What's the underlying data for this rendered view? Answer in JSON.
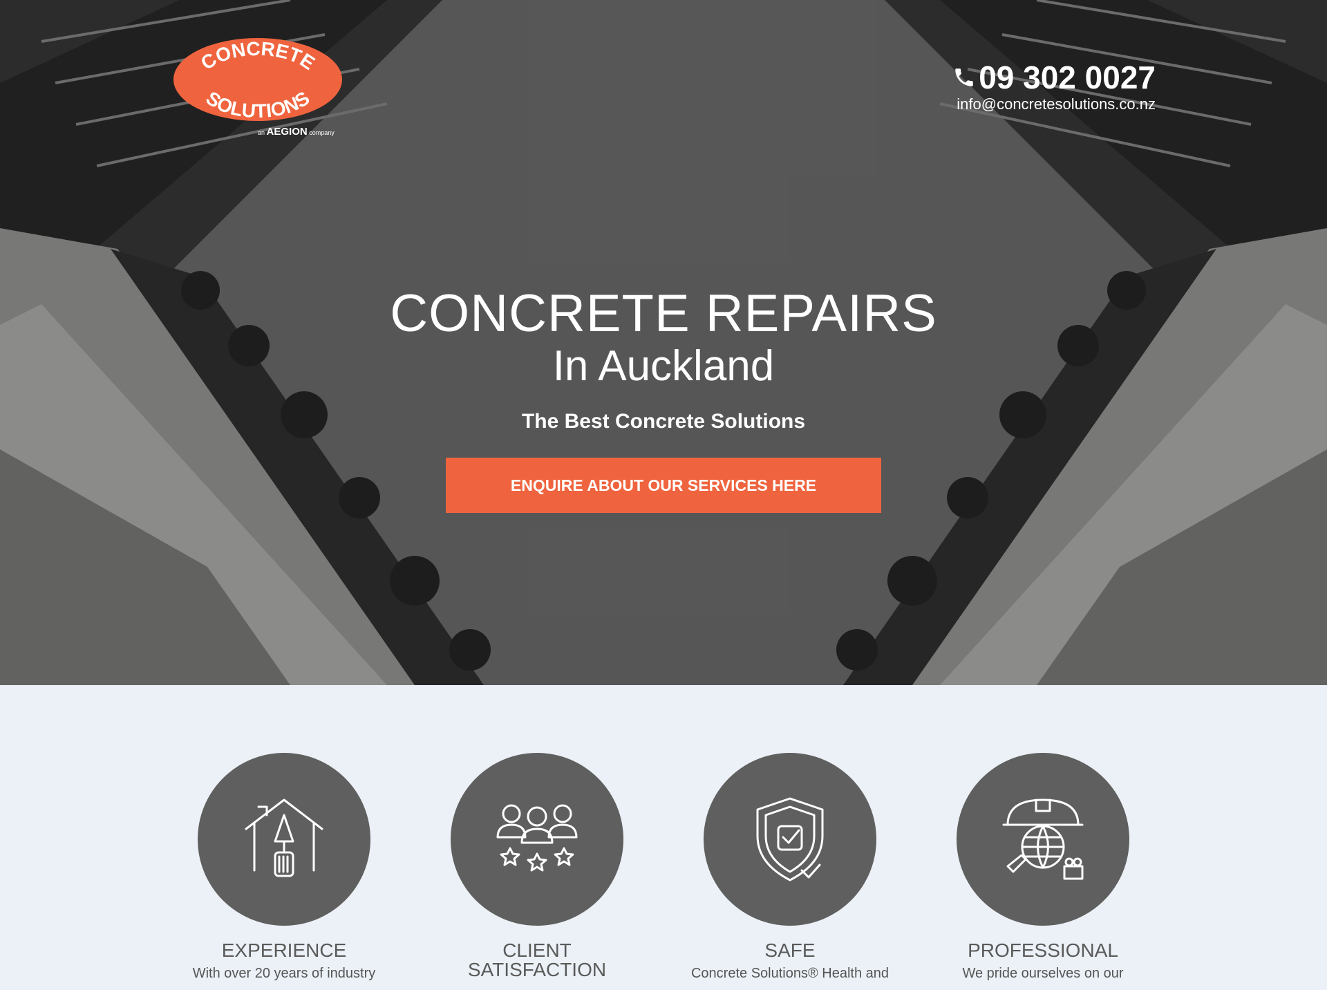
{
  "brand": {
    "logo_line1": "CONCRETE",
    "logo_line2": "SOLUTIONS",
    "logo_sub_prefix": "an",
    "logo_sub_brand": "AEGION",
    "logo_sub_suffix": "company",
    "accent_color": "#ef643e"
  },
  "contact": {
    "phone": "09 302 0027",
    "email": "info@concretesolutions.co.nz",
    "phone_icon": "phone-icon"
  },
  "hero": {
    "title": "CONCRETE REPAIRS",
    "subtitle": "In Auckland",
    "tagline": "The Best Concrete Solutions",
    "cta_label": "ENQUIRE ABOUT OUR SERVICES HERE"
  },
  "features": [
    {
      "title": "EXPERIENCE",
      "text": "With over 20 years of industry",
      "icon": "house-trowel-icon"
    },
    {
      "title_line1": "CLIENT",
      "title_line2": "SATISFACTION",
      "text": "",
      "icon": "clients-stars-icon"
    },
    {
      "title": "SAFE",
      "text": "Concrete Solutions® Health and",
      "icon": "shield-check-icon"
    },
    {
      "title": "PROFESSIONAL",
      "text": "We pride ourselves on our",
      "icon": "hardhat-globe-icon"
    }
  ]
}
